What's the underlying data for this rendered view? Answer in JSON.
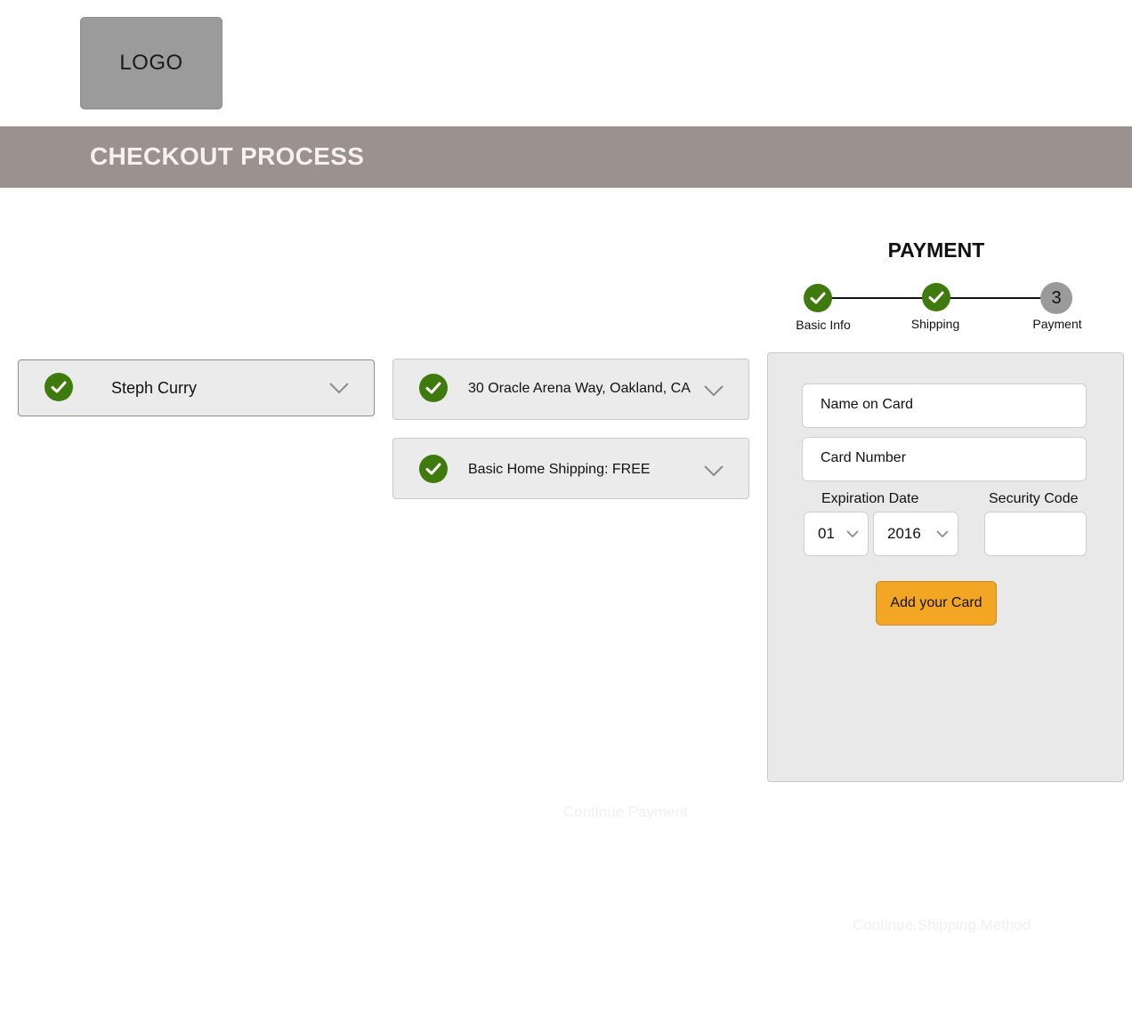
{
  "logo": {
    "text": "LOGO"
  },
  "banner": {
    "title": "CHECKOUT PROCESS"
  },
  "progress": {
    "title": "PAYMENT",
    "steps": [
      {
        "label": "Basic Info",
        "status": "complete",
        "icon": "check-icon"
      },
      {
        "label": "Shipping",
        "status": "complete",
        "icon": "check-icon"
      },
      {
        "label": "Payment",
        "status": "current",
        "number": "3"
      }
    ]
  },
  "summary": {
    "basic_info": {
      "label": "Steph Curry",
      "icon": "check-icon"
    },
    "address": {
      "label": "30 Oracle Arena Way, Oakland, CA",
      "icon": "check-icon"
    },
    "shipping_method": {
      "label": "Basic Home Shipping: FREE",
      "icon": "check-icon"
    }
  },
  "payment_form": {
    "name_placeholder": "Name on Card",
    "card_number_placeholder": "Card Number",
    "expiration_label": "Expiration Date",
    "security_label": "Security Code",
    "exp_month": "01",
    "exp_year": "2016",
    "security_value": "",
    "submit_label": "Add your Card"
  },
  "ghost_links": {
    "continue_payment": "Continue.Payment",
    "continue_shipping": "Continue.Shipping.Method"
  },
  "colors": {
    "banner": "#9b918f",
    "check": "#3f7a0e",
    "accent_button": "#f2a623",
    "panel": "#e9e9e9"
  }
}
